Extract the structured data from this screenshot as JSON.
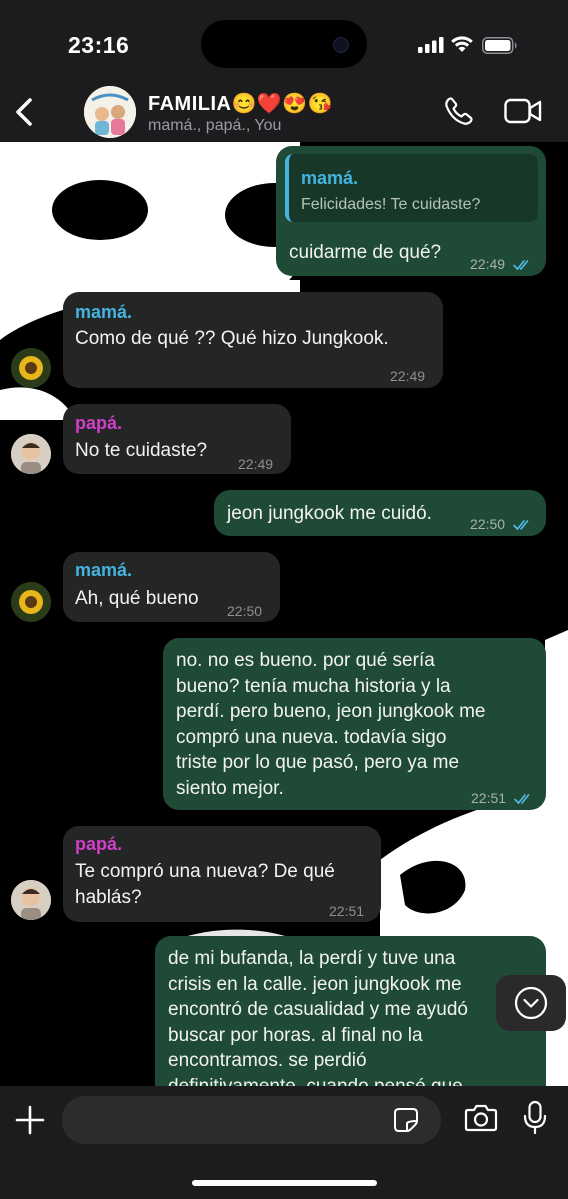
{
  "status_bar": {
    "time": "23:16"
  },
  "header": {
    "group_name": "FAMILIA😊❤️😍😘",
    "members": "mamá., papá., You"
  },
  "messages": [
    {
      "direction": "out",
      "quoted": {
        "sender": "mamá.",
        "text": "Felicidades! Te cuidaste?"
      },
      "text": "cuidarme de qué?",
      "time": "22:49",
      "status": "read"
    },
    {
      "direction": "in",
      "sender": "mamá.",
      "text": "Como de qué ?? Qué hizo Jungkook.",
      "time": "22:49"
    },
    {
      "direction": "in",
      "sender": "papá.",
      "text": "No te cuidaste?",
      "time": "22:49"
    },
    {
      "direction": "out",
      "text": "jeon jungkook me cuidó.",
      "time": "22:50",
      "status": "read"
    },
    {
      "direction": "in",
      "sender": "mamá.",
      "text": "Ah, qué bueno",
      "time": "22:50"
    },
    {
      "direction": "out",
      "lines": [
        "no. no es bueno. por qué sería",
        "bueno? tenía mucha historia y la",
        "perdí. pero bueno, jeon jungkook me",
        "compró una nueva. todavía sigo",
        "triste por lo que pasó, pero ya me",
        "siento mejor."
      ],
      "time": "22:51",
      "status": "read"
    },
    {
      "direction": "in",
      "sender": "papá.",
      "lines": [
        "Te compró una nueva? De qué",
        "hablás?"
      ],
      "time": "22:51"
    },
    {
      "direction": "out",
      "lines": [
        "de mi bufanda, la perdí y tuve una",
        "crisis en la calle. jeon jungkook me",
        "encontró de casualidad y me ayudó",
        "buscar por horas. al final no la",
        "encontramos. se perdió",
        "definitivamente. cuando pensé que"
      ]
    }
  ],
  "composer": {
    "value": "",
    "placeholder": ""
  },
  "icons": {
    "back": "chevron-left-icon",
    "call": "phone-icon",
    "video": "video-camera-icon",
    "scroll_down": "chevron-down-circle-icon",
    "attach": "plus-icon",
    "sticker": "sticker-icon",
    "camera": "camera-icon",
    "mic": "microphone-icon"
  },
  "colors": {
    "outgoing_bubble": "#1f4a35",
    "incoming_bubble": "#242626",
    "mama_name": "#45b3e0",
    "papa_name": "#d13fc9",
    "read_ticks": "#53bdeb",
    "bars": "#1c1c1e"
  }
}
